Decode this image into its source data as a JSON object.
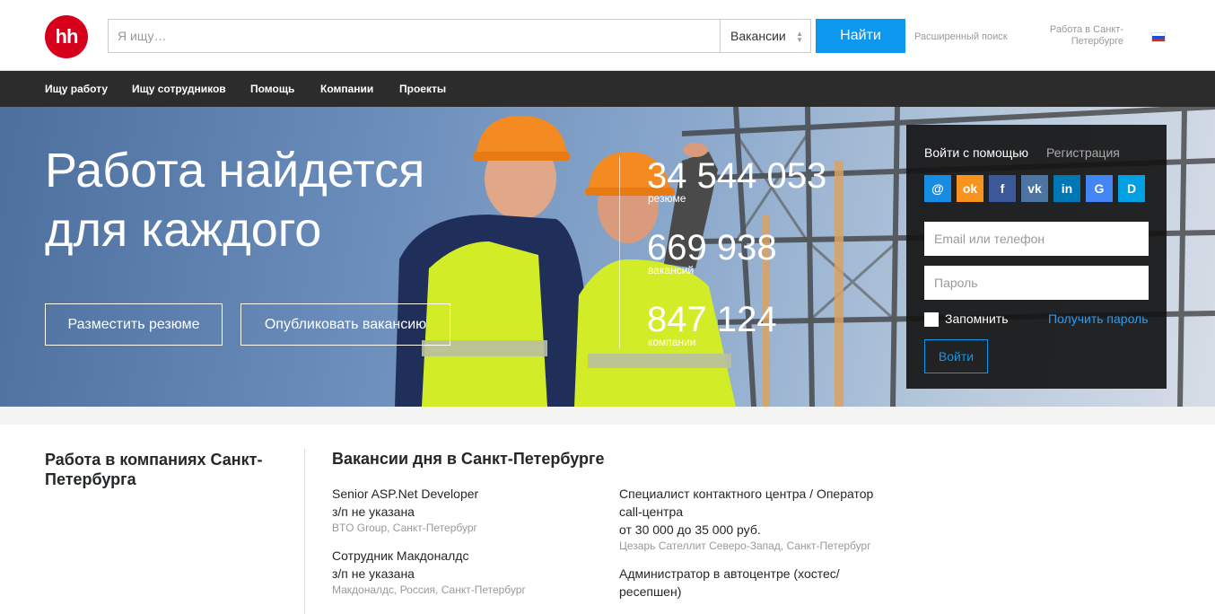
{
  "header": {
    "logo_text": "hh",
    "search_placeholder": "Я ищу…",
    "search_type": "Вакансии",
    "find_label": "Найти",
    "advanced_search": "Расширенный поиск",
    "region": "Работа в Санкт-Петербурге"
  },
  "nav": {
    "items": [
      "Ищу работу",
      "Ищу сотрудников",
      "Помощь",
      "Компании",
      "Проекты"
    ]
  },
  "hero": {
    "title": "Работа найдется для каждого",
    "post_resume": "Разместить резюме",
    "post_vacancy": "Опубликовать вакансию",
    "stats": [
      {
        "value": "34 544 053",
        "label": "резюме"
      },
      {
        "value": "669 938",
        "label": "вакансий"
      },
      {
        "value": "847 124",
        "label": "компании"
      }
    ]
  },
  "login": {
    "tab_login": "Войти с помощью",
    "tab_register": "Регистрация",
    "social": [
      {
        "name": "mail",
        "glyph": "@",
        "color": "#168de2"
      },
      {
        "name": "odnoklassniki",
        "glyph": "ok",
        "color": "#f7931e"
      },
      {
        "name": "facebook",
        "glyph": "f",
        "color": "#3b5998"
      },
      {
        "name": "vkontakte",
        "glyph": "vk",
        "color": "#4c75a3"
      },
      {
        "name": "linkedin",
        "glyph": "in",
        "color": "#0077b5"
      },
      {
        "name": "google",
        "glyph": "G",
        "color": "#4285f4"
      },
      {
        "name": "dnevnik",
        "glyph": "D",
        "color": "#00a0e3"
      }
    ],
    "email_placeholder": "Email или телефон",
    "password_placeholder": "Пароль",
    "remember": "Запомнить",
    "forgot": "Получить пароль",
    "submit": "Войти"
  },
  "content": {
    "companies_title": "Работа в компаниях Санкт-Петербурга",
    "vacancies_title": "Вакансии дня в Санкт-Петербурге",
    "vacancies": [
      {
        "title": "Senior ASP.Net Developer",
        "salary": "з/п не указана",
        "company": "BTO Group, Санкт-Петербург"
      },
      {
        "title": "Сотрудник Макдоналдс",
        "salary": "з/п не указана",
        "company": "Макдоналдс, Россия, Санкт-Петербург"
      },
      {
        "title": "Специалист контактного центра / Оператор call-центра",
        "salary": "от 30 000 до 35 000 руб.",
        "company": "Цезарь Сателлит Северо-Запад, Санкт-Петербург"
      },
      {
        "title": "Администратор в автоцентре (хостес/ ресепшен)",
        "salary": "",
        "company": ""
      }
    ]
  },
  "colors": {
    "brand_red": "#d6001c",
    "accent_blue": "#0e97ef",
    "nav_bg": "#2c2c2c"
  }
}
